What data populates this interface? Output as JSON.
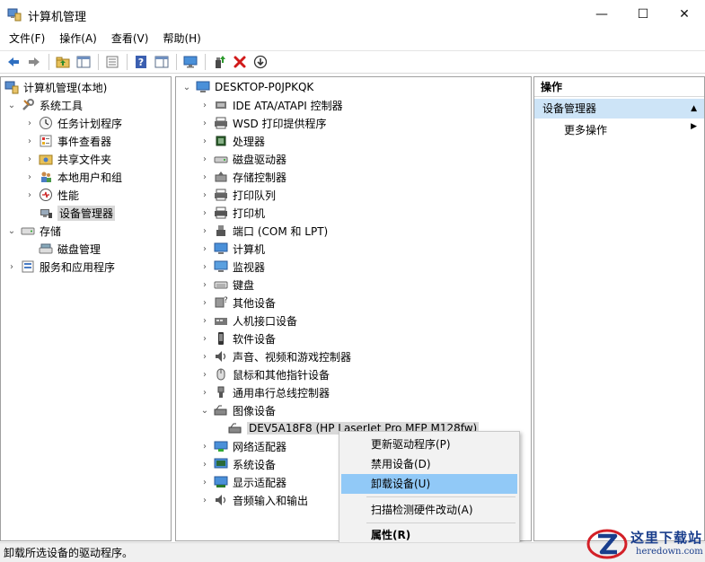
{
  "window": {
    "title": "计算机管理",
    "minimize_glyph": "—",
    "maximize_glyph": "☐",
    "close_glyph": "✕"
  },
  "menubar": {
    "items": [
      "文件(F)",
      "操作(A)",
      "查看(V)",
      "帮助(H)"
    ]
  },
  "toolbar": {
    "icons": [
      "back-icon",
      "forward-icon",
      "up-folder-icon",
      "show-hide-tree-icon",
      "export-list-icon",
      "help-icon",
      "show-action-pane-icon",
      "monitor-icon",
      "update-driver-icon",
      "uninstall-icon",
      "disable-icon"
    ]
  },
  "left_tree": {
    "items": [
      {
        "label": "计算机管理(本地)",
        "arrow": "",
        "icon": "computer-management-icon"
      },
      {
        "label": "系统工具",
        "arrow": "⌄",
        "icon": "tools-icon"
      },
      {
        "label": "任务计划程序",
        "arrow": "›",
        "icon": "clock-icon"
      },
      {
        "label": "事件查看器",
        "arrow": "›",
        "icon": "event-viewer-icon"
      },
      {
        "label": "共享文件夹",
        "arrow": "›",
        "icon": "shared-folder-icon"
      },
      {
        "label": "本地用户和组",
        "arrow": "›",
        "icon": "users-icon"
      },
      {
        "label": "性能",
        "arrow": "›",
        "icon": "performance-icon"
      },
      {
        "label": "设备管理器",
        "arrow": "",
        "icon": "device-manager-icon"
      },
      {
        "label": "存储",
        "arrow": "⌄",
        "icon": "storage-icon"
      },
      {
        "label": "磁盘管理",
        "arrow": "",
        "icon": "disk-management-icon"
      },
      {
        "label": "服务和应用程序",
        "arrow": "›",
        "icon": "services-icon"
      }
    ]
  },
  "device_tree": {
    "root": "DESKTOP-P0JPKQK",
    "items": [
      {
        "label": "IDE ATA/ATAPI 控制器",
        "icon": "ide-controller-icon"
      },
      {
        "label": "WSD 打印提供程序",
        "icon": "wsd-printer-icon"
      },
      {
        "label": "处理器",
        "icon": "processor-icon"
      },
      {
        "label": "磁盘驱动器",
        "icon": "disk-drive-icon"
      },
      {
        "label": "存储控制器",
        "icon": "storage-controller-icon"
      },
      {
        "label": "打印队列",
        "icon": "print-queue-icon"
      },
      {
        "label": "打印机",
        "icon": "printer-icon"
      },
      {
        "label": "端口 (COM 和 LPT)",
        "icon": "port-icon"
      },
      {
        "label": "计算机",
        "icon": "computer-icon"
      },
      {
        "label": "监视器",
        "icon": "monitor-icon"
      },
      {
        "label": "键盘",
        "icon": "keyboard-icon"
      },
      {
        "label": "其他设备",
        "icon": "other-devices-icon"
      },
      {
        "label": "人机接口设备",
        "icon": "hid-icon"
      },
      {
        "label": "软件设备",
        "icon": "software-device-icon"
      },
      {
        "label": "声音、视频和游戏控制器",
        "icon": "sound-icon"
      },
      {
        "label": "鼠标和其他指针设备",
        "icon": "mouse-icon"
      },
      {
        "label": "通用串行总线控制器",
        "icon": "usb-icon"
      },
      {
        "label": "图像设备",
        "icon": "imaging-device-icon"
      },
      {
        "label": "DEV5A18F8 (HP LaserJet Pro MFP M128fw)",
        "icon": "scanner-icon"
      },
      {
        "label": "网络适配器",
        "icon": "network-adapter-icon"
      },
      {
        "label": "系统设备",
        "icon": "system-device-icon"
      },
      {
        "label": "显示适配器",
        "icon": "display-adapter-icon"
      },
      {
        "label": "音频输入和输出",
        "icon": "audio-io-icon"
      }
    ]
  },
  "actions_pane": {
    "header": "操作",
    "section": "设备管理器",
    "more": "更多操作",
    "collapse_glyph": "▲",
    "more_glyph": "▶"
  },
  "context_menu": {
    "items": [
      "更新驱动程序(P)",
      "禁用设备(D)",
      "卸载设备(U)",
      "扫描检测硬件改动(A)",
      "属性(R)"
    ],
    "highlighted": "卸载设备(U)"
  },
  "statusbar": {
    "text": "卸载所选设备的驱动程序。"
  },
  "watermark": {
    "title": "这里下载站",
    "url": "heredown.com"
  }
}
